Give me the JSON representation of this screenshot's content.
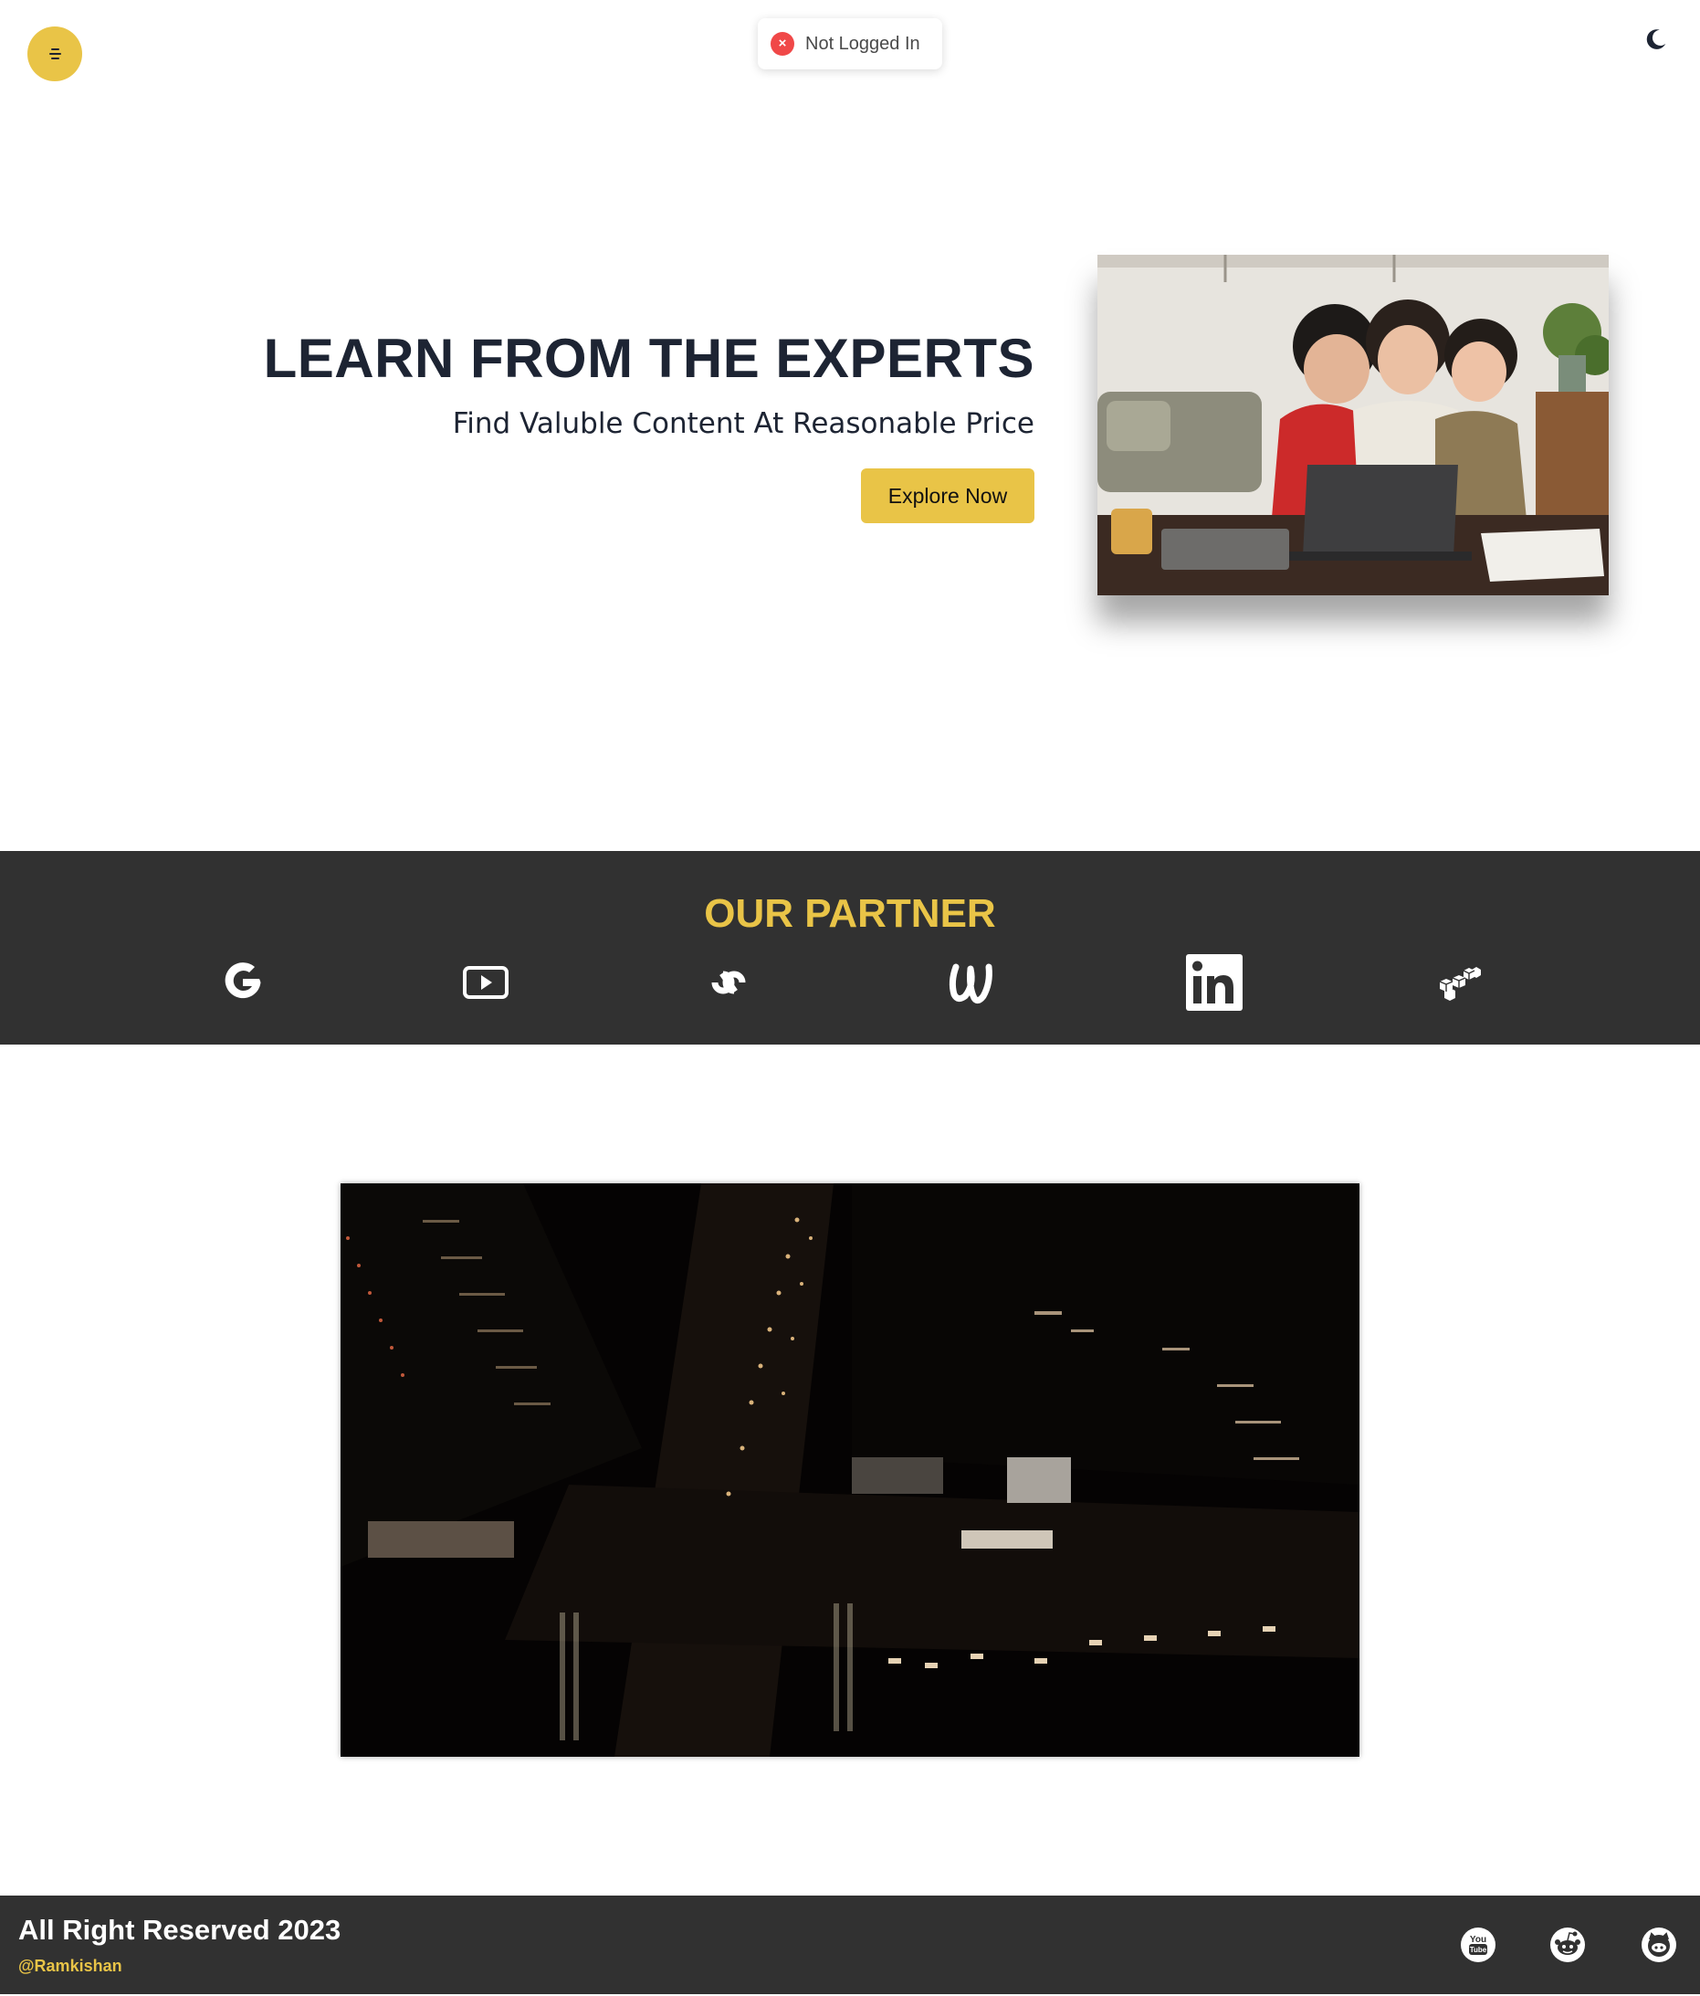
{
  "header": {
    "menu_icon": "menu-icon",
    "theme_toggle_icon": "moon-icon",
    "status_toast": {
      "icon": "error-x-icon",
      "text": "Not Logged In",
      "color": "#f04848"
    }
  },
  "hero": {
    "title": "LEARN FROM THE EXPERTS",
    "subtitle": "Find Valuble Content At Reasonable Price",
    "cta_label": "Explore Now",
    "image_alt": "family-learning-on-laptop"
  },
  "partners": {
    "title": "OUR PARTNER",
    "logos": [
      "google-icon",
      "youtube-play-icon",
      "coursera-icon",
      "udemy-icon",
      "linkedin-icon",
      "codepen-boxes-icon"
    ]
  },
  "video": {
    "content": "aerial-city-night-video"
  },
  "footer": {
    "copyright": "All Right Reserved 2023",
    "handle": "@Ramkishan",
    "social_icons": [
      "youtube-icon",
      "reddit-icon",
      "github-icon"
    ]
  },
  "colors": {
    "accent": "#e9c447",
    "dark_band": "#313131",
    "heading": "#1d2433",
    "error": "#f04848"
  }
}
